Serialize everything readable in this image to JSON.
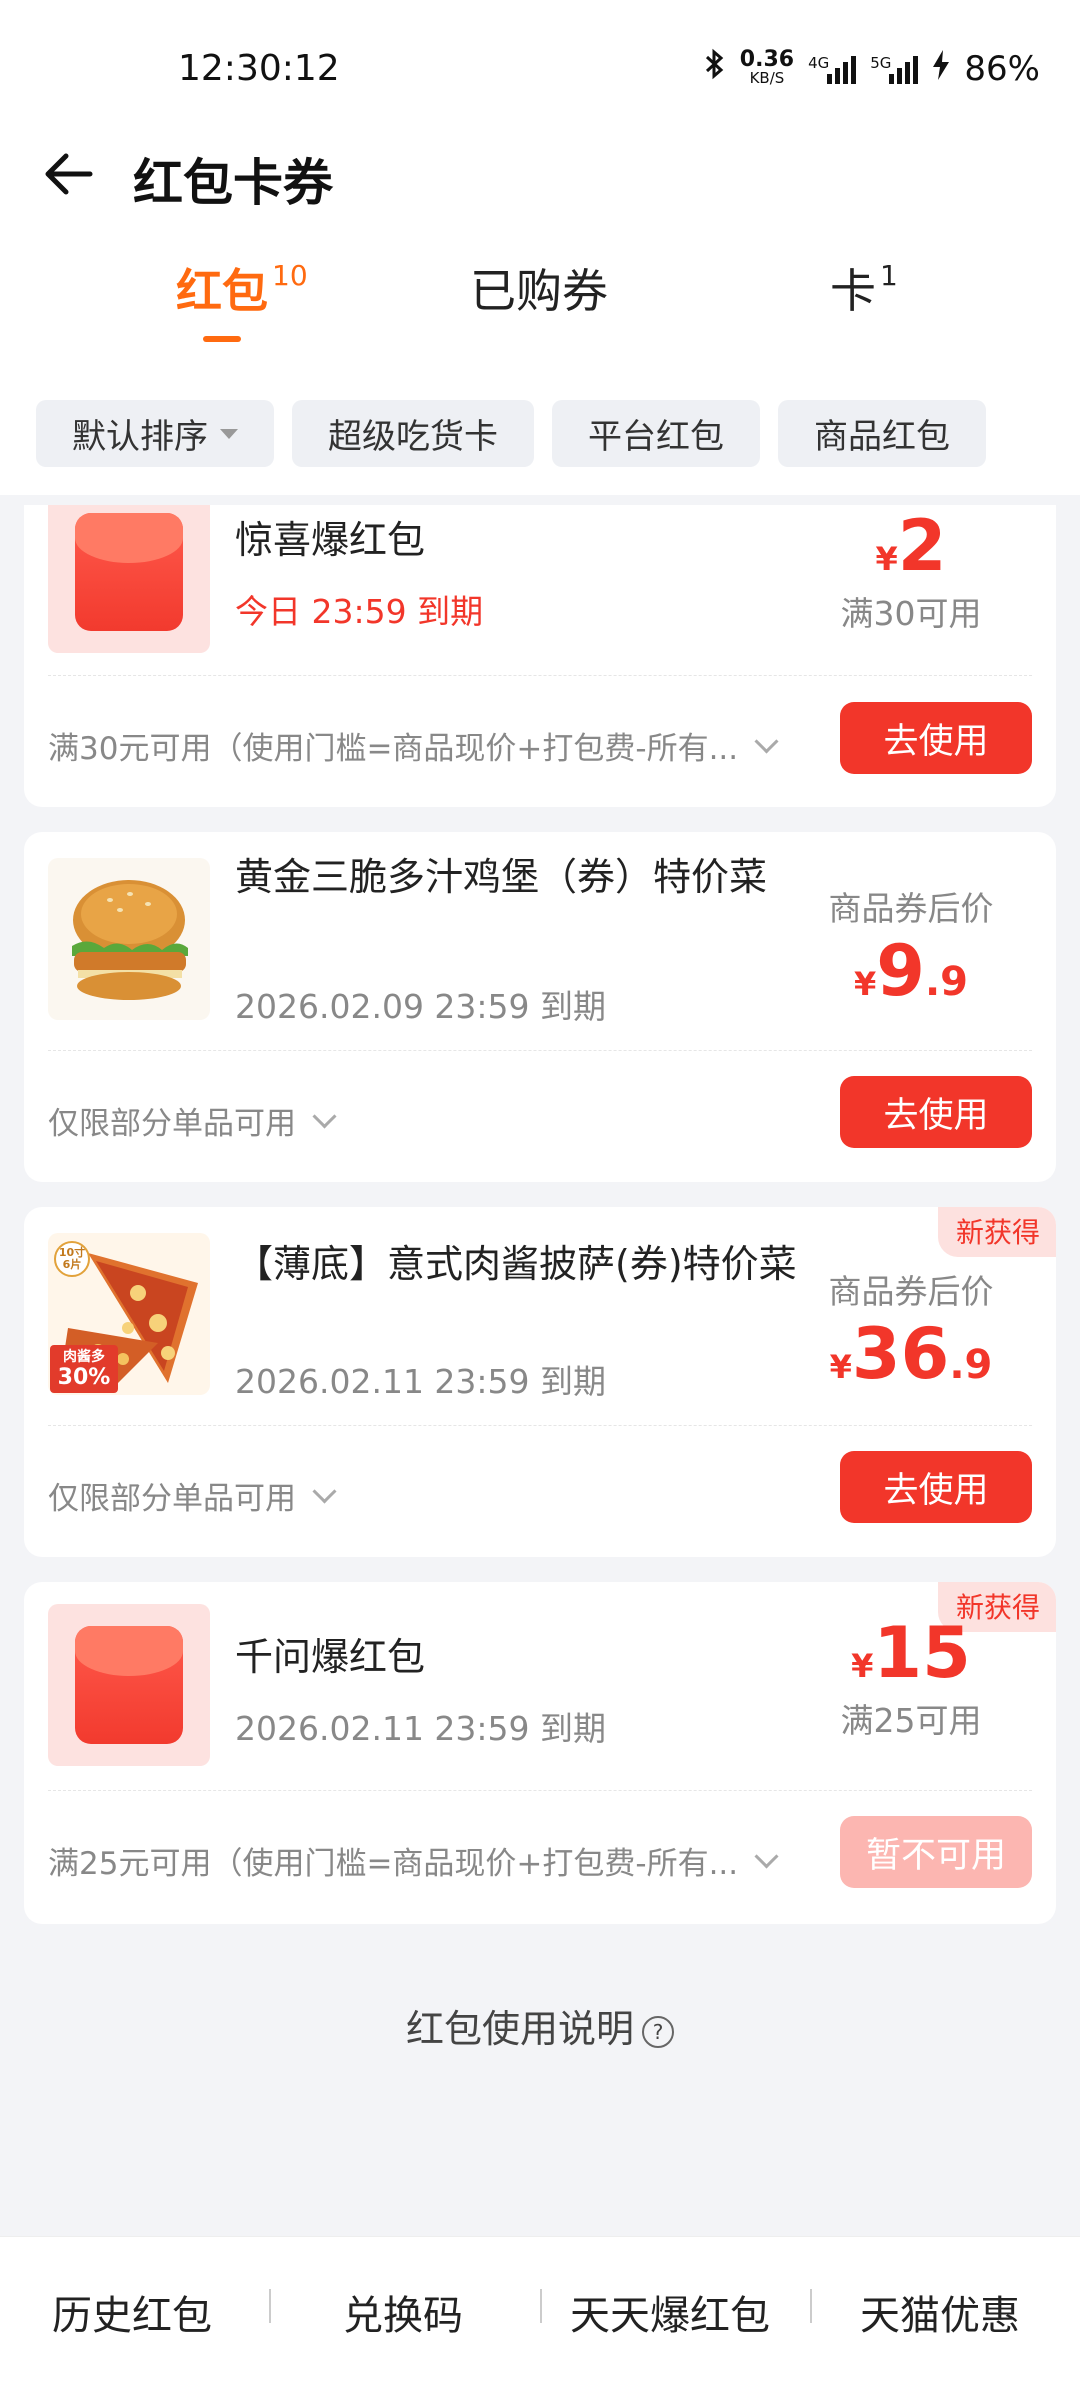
{
  "status_bar": {
    "time": "12:30:12",
    "net_speed_top": "0.36",
    "net_speed_unit": "KB/S",
    "net_type1": "4G",
    "net_type2": "5G",
    "battery": "86%"
  },
  "header": {
    "title": "红包卡券"
  },
  "tabs": [
    {
      "label": "红包",
      "count": "10",
      "active": true
    },
    {
      "label": "已购券",
      "count": ""
    },
    {
      "label": "卡",
      "count": "1"
    }
  ],
  "filters": [
    {
      "label": "默认排序",
      "has_dropdown": true
    },
    {
      "label": "超级吃货卡"
    },
    {
      "label": "平台红包"
    },
    {
      "label": "商品红包"
    }
  ],
  "cards": [
    {
      "title": "惊喜爆红包",
      "expire": "今日 23:59 到期",
      "price_int": "2",
      "price_cond": "满30可用",
      "rule": "满30元可用（使用门槛=商品现价+打包费-所有...",
      "button": "去使用",
      "icon": "red-envelope-icon"
    },
    {
      "title": "黄金三脆多汁鸡堡（券）特价菜",
      "expire": "2026.02.09 23:59 到期",
      "price_label": "商品券后价",
      "price_int": "9",
      "price_dec": ".9",
      "rule": "仅限部分单品可用",
      "button": "去使用",
      "icon": "burger-image"
    },
    {
      "title": "【薄底】意式肉酱披萨(券)特价菜",
      "expire": "2026.02.11 23:59 到期",
      "price_label": "商品券后价",
      "price_int": "36",
      "price_dec": ".9",
      "rule": "仅限部分单品可用",
      "button": "去使用",
      "badge": "新获得",
      "pizza_tag_top": "10寸",
      "pizza_tag_bottom": "6片",
      "pizza_promo": "肉酱多",
      "pizza_promo_pct": "30%",
      "icon": "pizza-image"
    },
    {
      "title": "千问爆红包",
      "expire": "2026.02.11 23:59 到期",
      "price_int": "15",
      "price_cond": "满25可用",
      "rule": "满25元可用（使用门槛=商品现价+打包费-所有...",
      "button": "暂不可用",
      "badge": "新获得",
      "icon": "red-envelope-icon"
    }
  ],
  "currency_symbol": "¥",
  "help": {
    "label": "红包使用说明",
    "icon": "?"
  },
  "bottom_bar": [
    "历史红包",
    "兑换码",
    "天天爆红包",
    "天猫优惠"
  ]
}
